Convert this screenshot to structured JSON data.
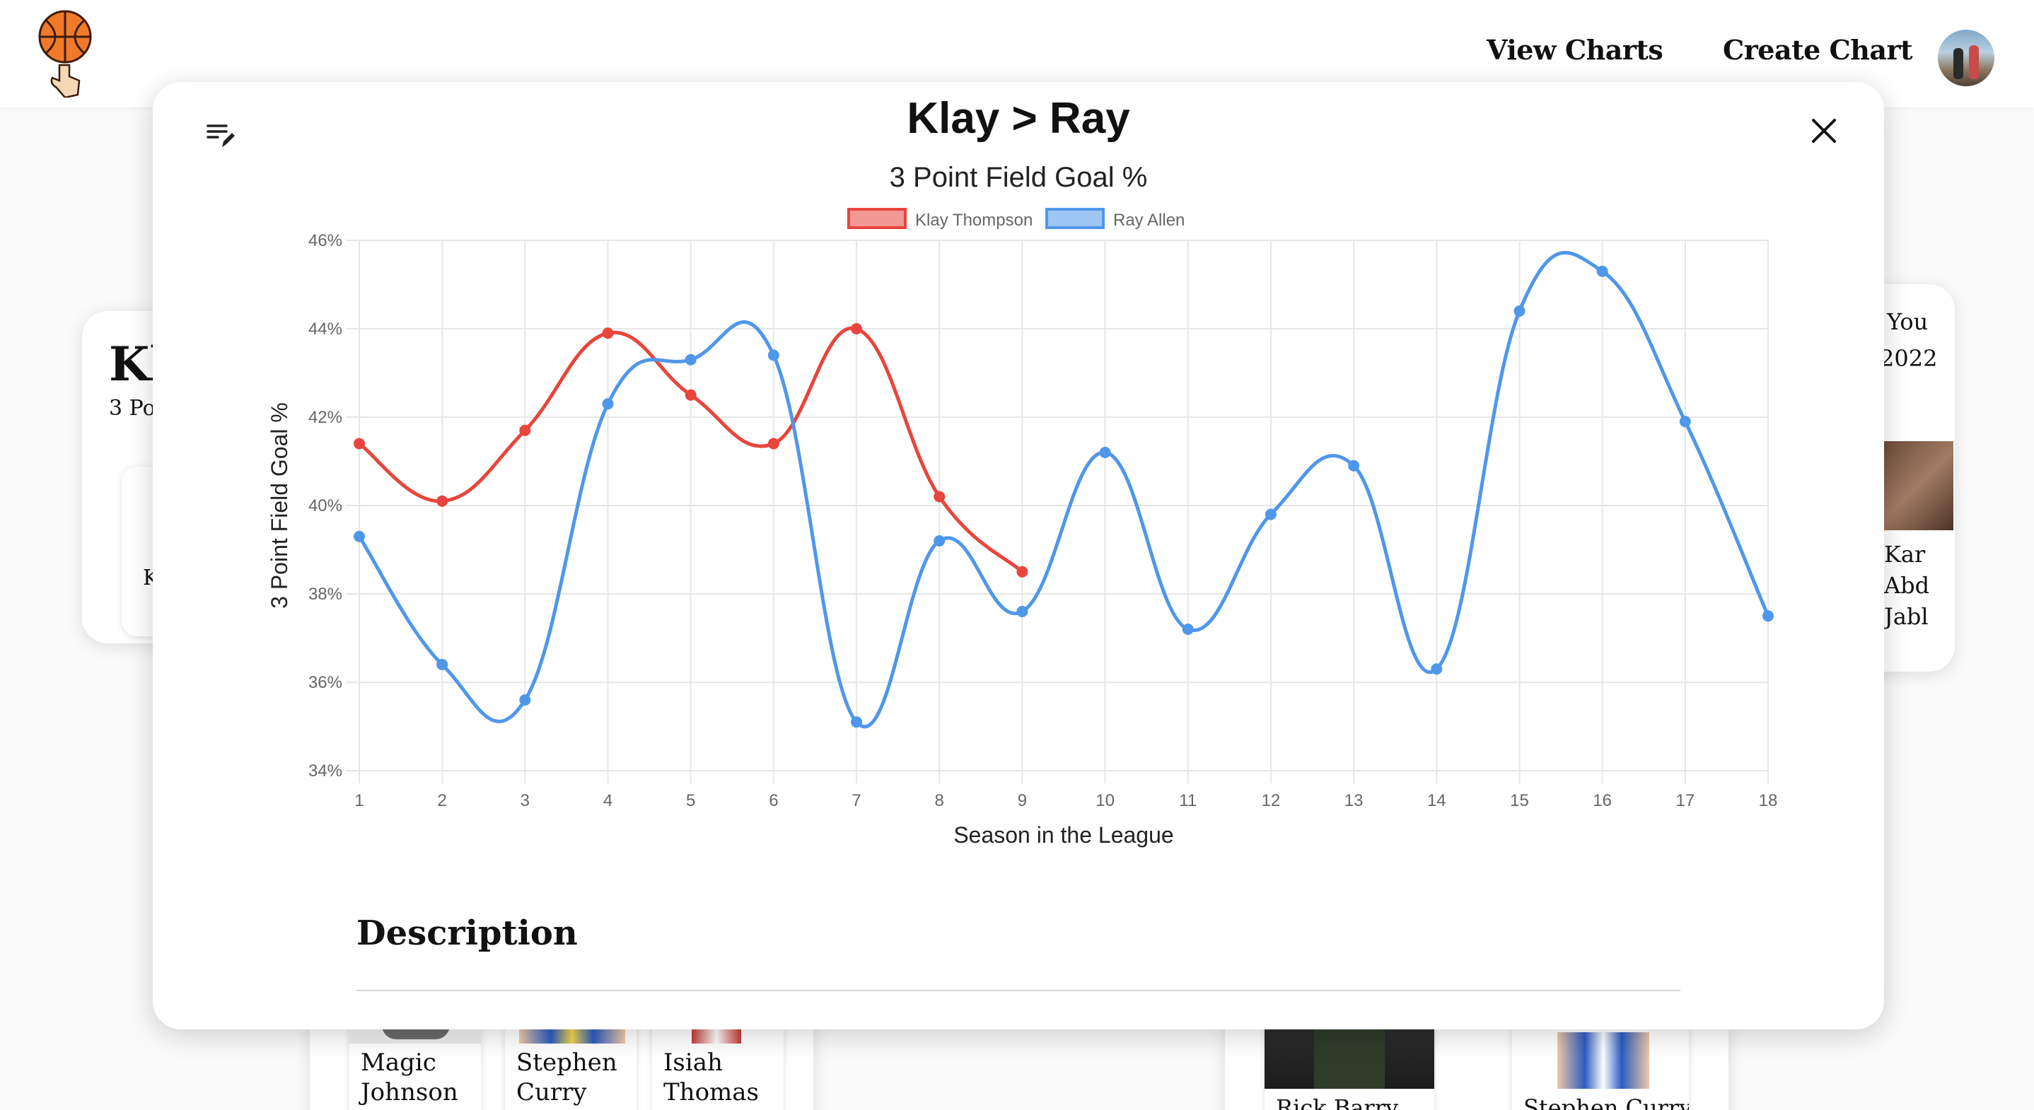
{
  "nav": {
    "view_charts": "View Charts",
    "create_chart": "Create Chart"
  },
  "modal": {
    "title": "Klay > Ray",
    "description_heading": "Description"
  },
  "background": {
    "left_card_title": "Kl",
    "left_card_subtitle": "3 Po",
    "left_card_player": "Kl",
    "right_card_line1": "You",
    "right_card_line2": "2022",
    "right_card_player": "Kar\nAbd\nJabl",
    "bottom_players_left": [
      "Magic\nJohnson",
      "Stephen\nCurry",
      "Isiah\nThomas"
    ],
    "bottom_players_right": [
      "Rick Barry",
      "Stephen Curry"
    ]
  },
  "chart_data": {
    "type": "line",
    "title": "3 Point Field Goal %",
    "xlabel": "Season in the League",
    "ylabel": "3 Point Field Goal %",
    "x": [
      1,
      2,
      3,
      4,
      5,
      6,
      7,
      8,
      9,
      10,
      11,
      12,
      13,
      14,
      15,
      16,
      17,
      18
    ],
    "ylim": [
      34,
      46
    ],
    "yticks": [
      "34%",
      "36%",
      "38%",
      "40%",
      "42%",
      "44%",
      "46%"
    ],
    "grid": true,
    "legend_position": "top-center",
    "series": [
      {
        "name": "Klay Thompson",
        "color": "#e8453c",
        "values": [
          41.4,
          40.1,
          41.7,
          43.9,
          42.5,
          41.4,
          44.0,
          40.2,
          38.5
        ]
      },
      {
        "name": "Ray Allen",
        "color": "#4f97ea",
        "values": [
          39.3,
          36.4,
          35.6,
          42.3,
          43.3,
          43.4,
          35.1,
          39.2,
          37.6,
          41.2,
          37.2,
          39.8,
          40.9,
          36.3,
          44.4,
          45.3,
          41.9,
          37.5
        ]
      }
    ]
  },
  "colors": {
    "klay": "#e8453c",
    "ray": "#4f97ea",
    "grid": "#e6e6e6"
  }
}
